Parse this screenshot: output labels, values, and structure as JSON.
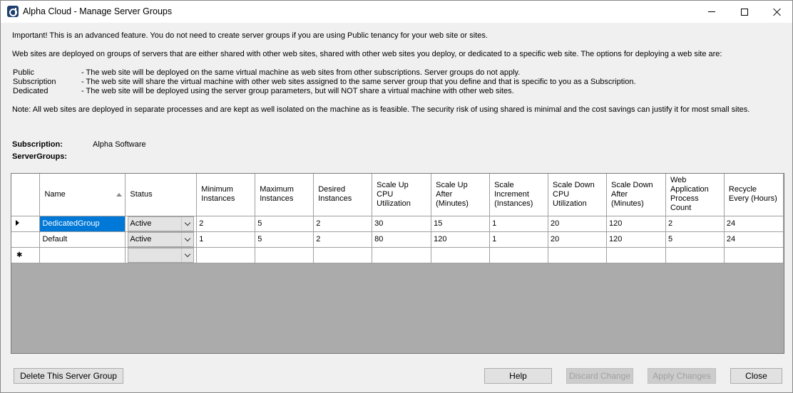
{
  "window": {
    "title": "Alpha Cloud - Manage Server Groups"
  },
  "intro": {
    "important": "Important!  This is an advanced feature.  You do not need to create server groups if you are using Public tenancy for your web site or sites.",
    "deploy": "Web sites are deployed on groups of servers that are either shared with other web sites, shared with other web sites you deploy, or dedicated to a specific web site.  The options for deploying a web site are:",
    "options": [
      {
        "name": "Public",
        "desc": "- The web site will be deployed on the same virtual machine as web sites from other subscriptions.  Server groups do not apply."
      },
      {
        "name": "Subscription",
        "desc": "- The web site will share the virtual machine with other web sites assigned to the same server group that you define and that is specific to you as a Subscription."
      },
      {
        "name": "Dedicated",
        "desc": "- The web site will be deployed using the server group parameters, but will NOT share a virtual machine with other web sites."
      }
    ],
    "note": "Note:  All web sites are deployed in separate processes and are kept as well isolated on the machine as is feasible.  The security risk of using shared is minimal and the cost savings can justify it for most small sites."
  },
  "subscription": {
    "label": "Subscription:",
    "value": "Alpha Software"
  },
  "servergroups_label": "ServerGroups:",
  "grid": {
    "columns": [
      "Name",
      "Status",
      "Minimum Instances",
      "Maximum Instances",
      "Desired Instances",
      "Scale Up CPU Utilization",
      "Scale Up After (Minutes)",
      "Scale Increment (Instances)",
      "Scale Down CPU Utilization",
      "Scale Down After (Minutes)",
      "Web Application Process Count",
      "Recycle Every (Hours)"
    ],
    "rows": [
      [
        "DedicatedGroup",
        "Active",
        "2",
        "5",
        "2",
        "30",
        "15",
        "1",
        "20",
        "120",
        "2",
        "24"
      ],
      [
        "Default",
        "Active",
        "1",
        "5",
        "2",
        "80",
        "120",
        "1",
        "20",
        "120",
        "5",
        "24"
      ]
    ]
  },
  "buttons": {
    "delete": "Delete This Server Group",
    "help": "Help",
    "discard": "Discard Change",
    "apply": "Apply Changes",
    "close": "Close"
  }
}
